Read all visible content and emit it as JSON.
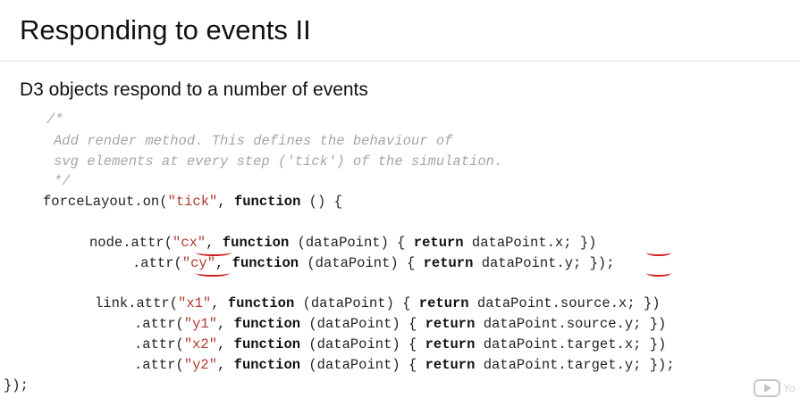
{
  "slide": {
    "title": "Responding to events II",
    "subtitle": "D3 objects respond to a number of events"
  },
  "code": {
    "comment": [
      "/*",
      "Add render method. This defines the behaviour of",
      "svg elements at every step ('tick') of the simulation.",
      "*/"
    ],
    "on_line": {
      "obj": "forceLayout.on(",
      "event": "\"tick\"",
      "sep": ", ",
      "kw": "function",
      "rest": " () {"
    },
    "node_lines": [
      {
        "pre": "node.attr(",
        "attr": "\"cx\"",
        "mid": ", ",
        "kw_fn": "function",
        "args": " (dataPoint) { ",
        "kw_ret": "return",
        "body": " dataPoint.x; })"
      },
      {
        "pre": ".attr(",
        "attr": "\"cy\"",
        "mid": ", ",
        "kw_fn": "function",
        "args": " (dataPoint) { ",
        "kw_ret": "return",
        "body": " dataPoint.y; });"
      }
    ],
    "link_lines": [
      {
        "pre": "link.attr(",
        "attr": "\"x1\"",
        "mid": ", ",
        "kw_fn": "function",
        "args": " (dataPoint) { ",
        "kw_ret": "return",
        "body": " dataPoint.source.x; })"
      },
      {
        "pre": ".attr(",
        "attr": "\"y1\"",
        "mid": ", ",
        "kw_fn": "function",
        "args": " (dataPoint) { ",
        "kw_ret": "return",
        "body": " dataPoint.source.y; })"
      },
      {
        "pre": ".attr(",
        "attr": "\"x2\"",
        "mid": ", ",
        "kw_fn": "function",
        "args": " (dataPoint) { ",
        "kw_ret": "return",
        "body": " dataPoint.target.x; })"
      },
      {
        "pre": ".attr(",
        "attr": "\"y2\"",
        "mid": ", ",
        "kw_fn": "function",
        "args": " (dataPoint) { ",
        "kw_ret": "return",
        "body": " dataPoint.target.y; });"
      }
    ],
    "closing": "});"
  },
  "watermark": {
    "icon": "youtube-play-icon",
    "text": "Yo"
  },
  "colors": {
    "string": "#b03a2e",
    "comment": "#a6a6a6",
    "annotation": "#d21f1f"
  }
}
